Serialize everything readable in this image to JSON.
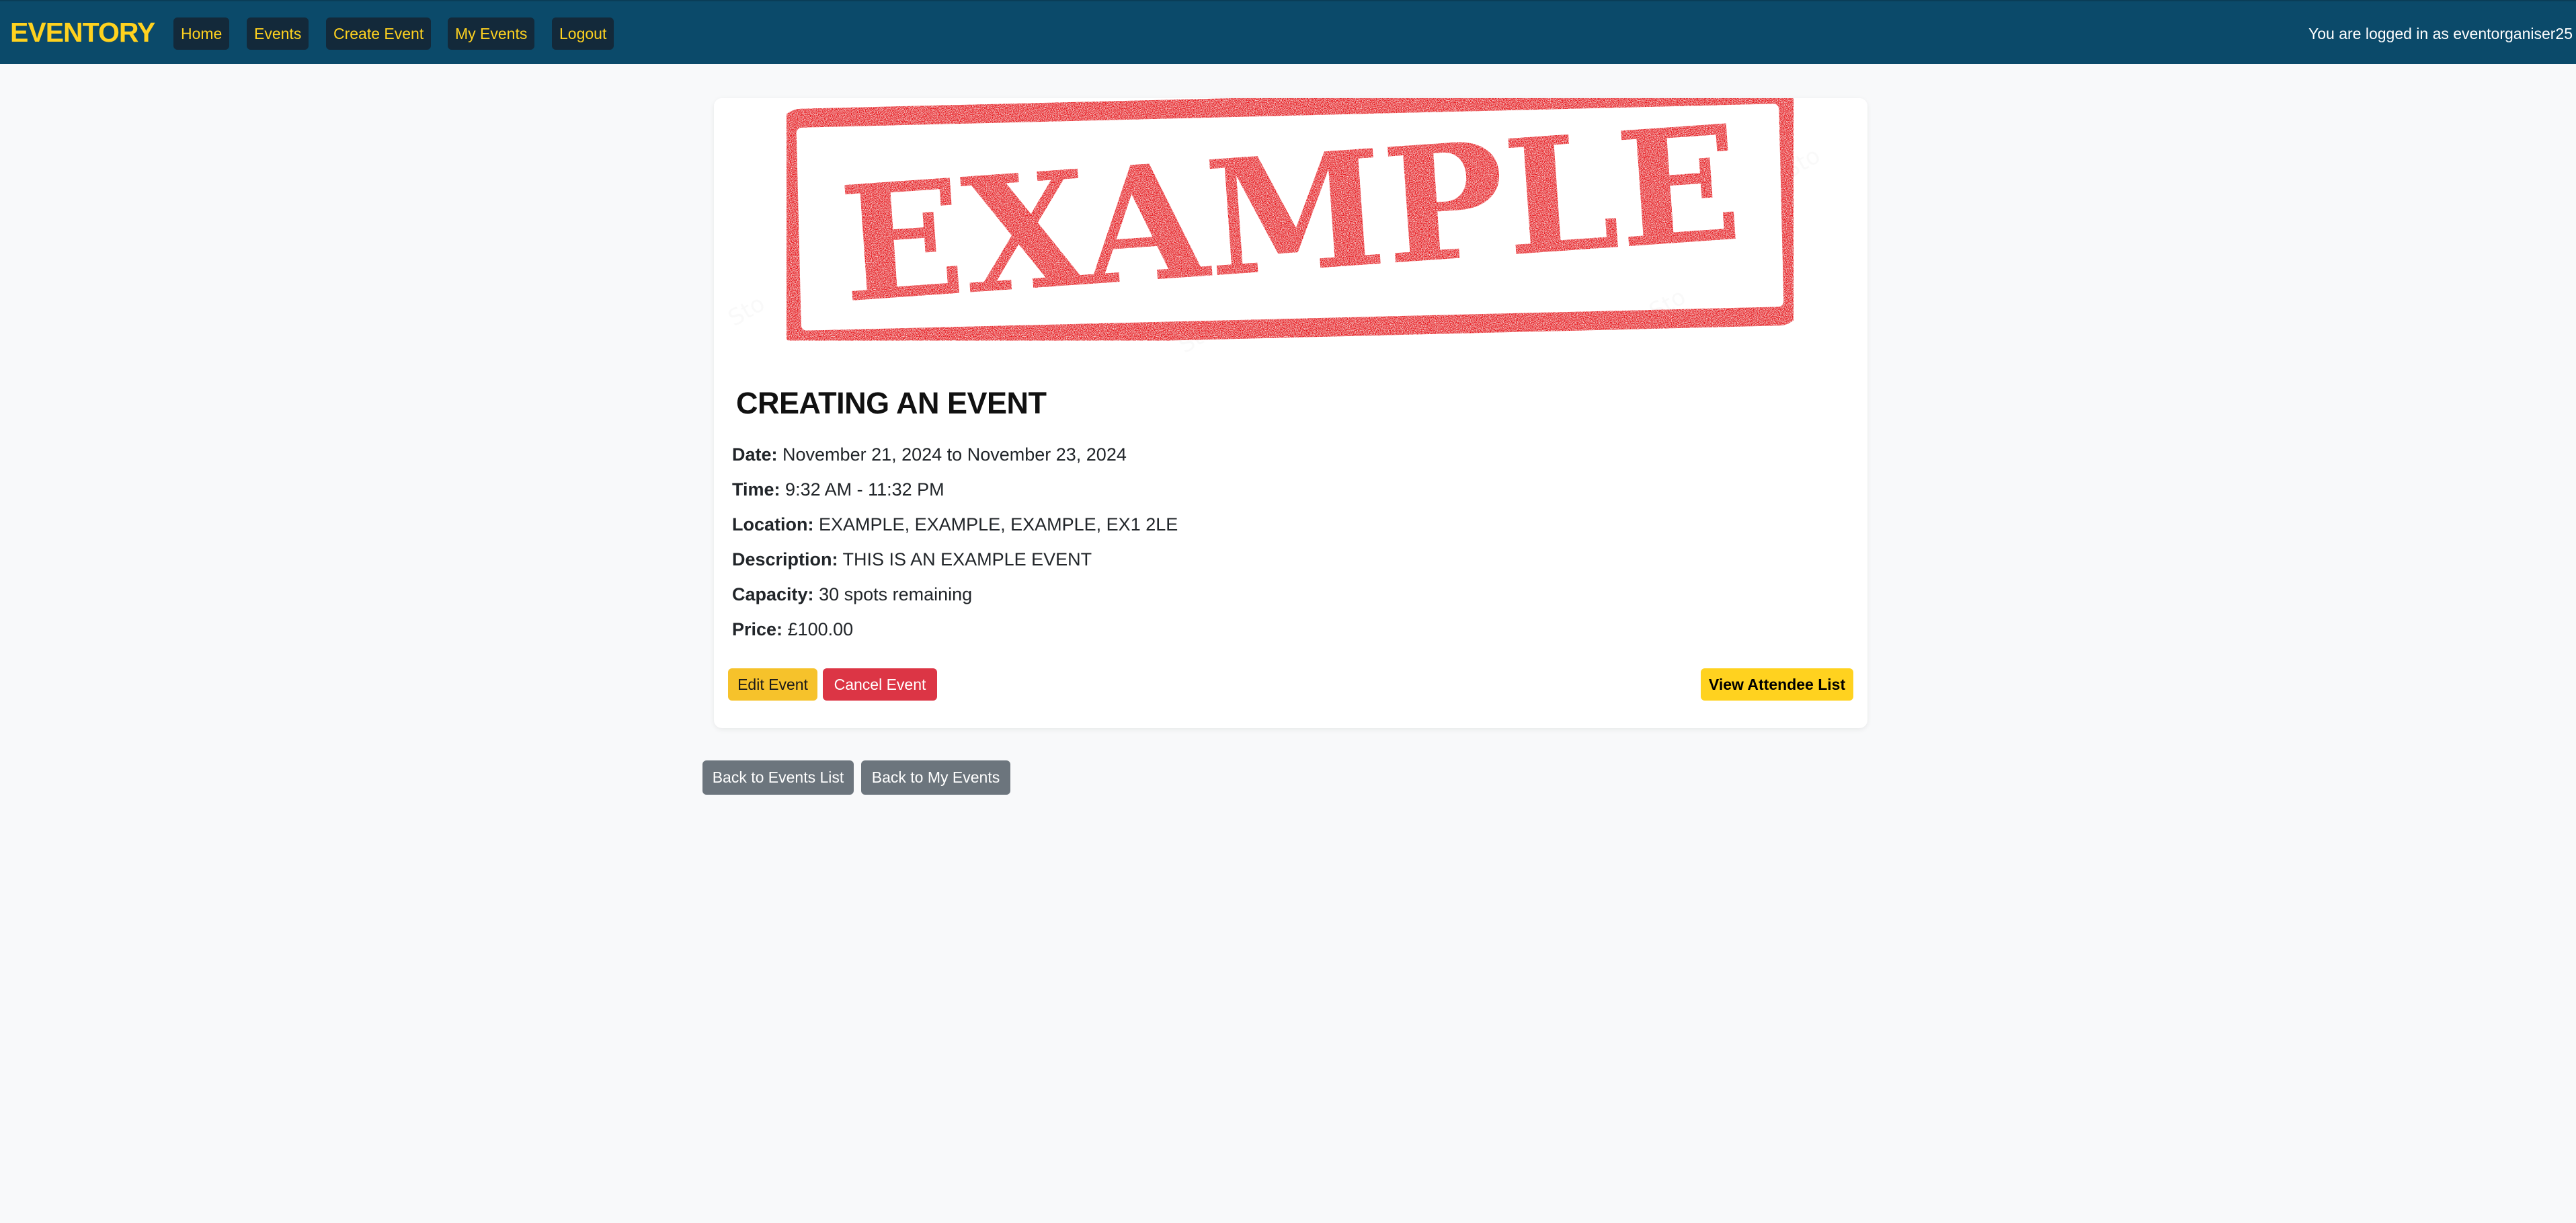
{
  "navbar": {
    "brand": "EVENTORY",
    "links": [
      "Home",
      "Events",
      "Create Event",
      "My Events",
      "Logout"
    ],
    "login_status": "You are logged in as eventorganiser25",
    "colors": {
      "background": "#0b4a6a",
      "accent": "#ffd21f",
      "button_bg": "#13293a"
    }
  },
  "event": {
    "image_stamp_text": "EXAMPLE",
    "title": "CREATING AN EVENT",
    "details": [
      {
        "label": "Date:",
        "value": "November 21, 2024 to November 23, 2024"
      },
      {
        "label": "Time:",
        "value": "9:32 AM - 11:32 PM"
      },
      {
        "label": "Location:",
        "value": "EXAMPLE, EXAMPLE, EXAMPLE, EX1 2LE"
      },
      {
        "label": "Description:",
        "value": "THIS IS AN EXAMPLE EVENT"
      },
      {
        "label": "Capacity:",
        "value": "30 spots remaining"
      },
      {
        "label": "Price:",
        "value": "£100.00"
      }
    ],
    "actions": {
      "edit": "Edit Event",
      "cancel": "Cancel Event",
      "attendee_list": "View Attendee List"
    }
  },
  "footer_actions": {
    "back_events": "Back to Events List",
    "back_my_events": "Back to My Events"
  },
  "colors": {
    "page_bg": "#f8f9fa",
    "stamp_red": "#e8141c",
    "edit": "#f6c22b",
    "cancel": "#dc3545",
    "attendee": "#ffd21f",
    "secondary": "#6c757d"
  }
}
